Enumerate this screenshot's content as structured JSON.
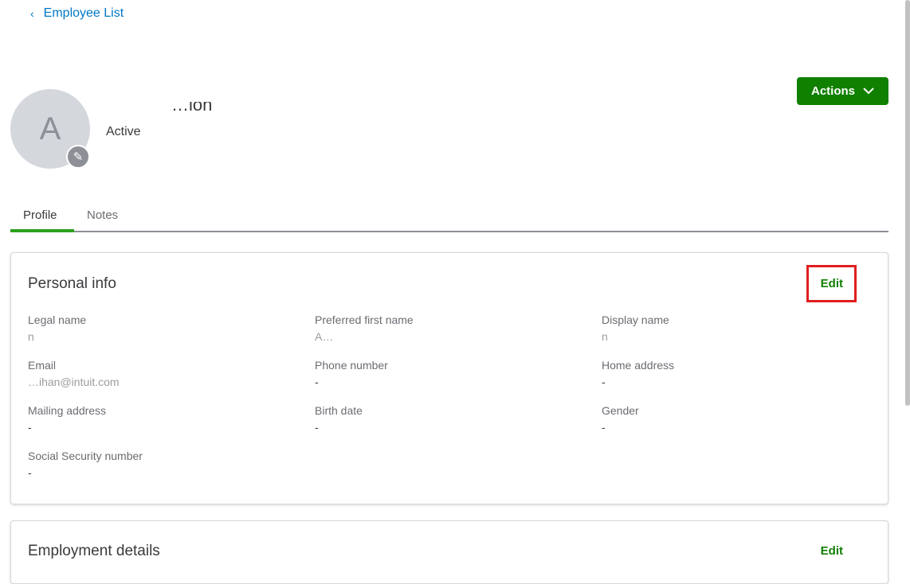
{
  "nav": {
    "back_label": "Employee List"
  },
  "employee": {
    "initial": "A",
    "name": "…ion",
    "status": "Active"
  },
  "actions_label": "Actions",
  "tabs": [
    "Profile",
    "Notes"
  ],
  "personal": {
    "title": "Personal info",
    "edit": "Edit",
    "fields": [
      {
        "label": "Legal name",
        "value": "n"
      },
      {
        "label": "Preferred first name",
        "value": "A…"
      },
      {
        "label": "Display name",
        "value": "n"
      },
      {
        "label": "Email",
        "value": "…ihan@intuit.com"
      },
      {
        "label": "Phone number",
        "value": "-"
      },
      {
        "label": "Home address",
        "value": "-"
      },
      {
        "label": "Mailing address",
        "value": "-"
      },
      {
        "label": "Birth date",
        "value": "-"
      },
      {
        "label": "Gender",
        "value": "-"
      },
      {
        "label": "Social Security number",
        "value": "-"
      }
    ]
  },
  "employment": {
    "title": "Employment details",
    "edit": "Edit"
  }
}
